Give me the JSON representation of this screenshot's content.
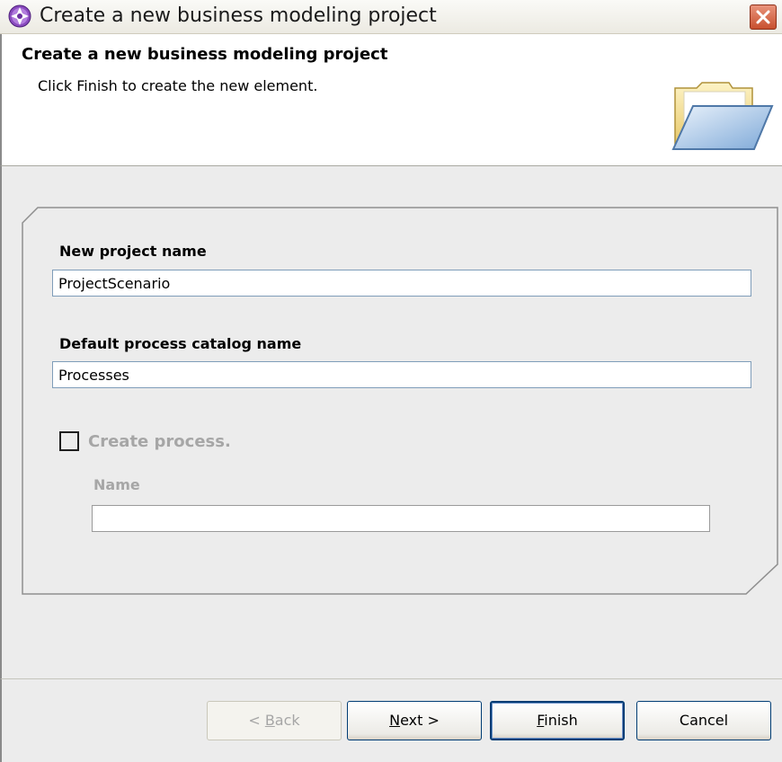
{
  "window": {
    "title": "Create a new business modeling project",
    "close_label": "Close"
  },
  "banner": {
    "title": "Create a new business modeling project",
    "description": "Click Finish to create the new element."
  },
  "form": {
    "project_name_label": "New project name",
    "project_name_value": "ProjectScenario",
    "catalog_label": "Default process catalog name",
    "catalog_value": "Processes",
    "create_process_label": "Create process.",
    "create_process_checked": false,
    "process_name_label": "Name",
    "process_name_value": ""
  },
  "buttons": {
    "back": {
      "mnemonic": "B",
      "rest": "ack",
      "prefix": "< "
    },
    "next": {
      "mnemonic": "N",
      "rest": "ext >"
    },
    "finish": {
      "mnemonic": "F",
      "rest": "inish"
    },
    "cancel": "Cancel"
  },
  "colors": {
    "disabled_text": "#a6a6a6",
    "panel_bg": "#ececec",
    "input_border": "#7f9db9"
  },
  "icons": {
    "app": "business-modeler-icon",
    "banner": "open-folder-icon",
    "close": "close-icon"
  }
}
